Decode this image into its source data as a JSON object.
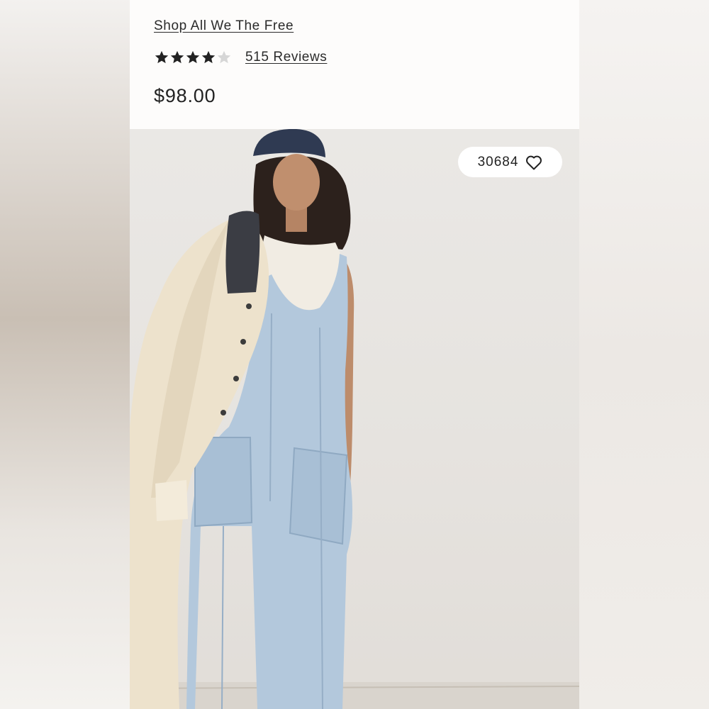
{
  "product": {
    "shop_link": "Shop All We The Free",
    "rating": 4,
    "rating_max": 5,
    "reviews_link": "515 Reviews",
    "price": "$98.00"
  },
  "photo": {
    "favorite_count": "30684",
    "favorite_icon": "heart-outline-icon"
  },
  "colors": {
    "text": "#222222",
    "star_filled": "#222222",
    "star_empty": "#d6d6d6",
    "denim": "#b3c8dc",
    "jacket": "#ede2cc"
  }
}
